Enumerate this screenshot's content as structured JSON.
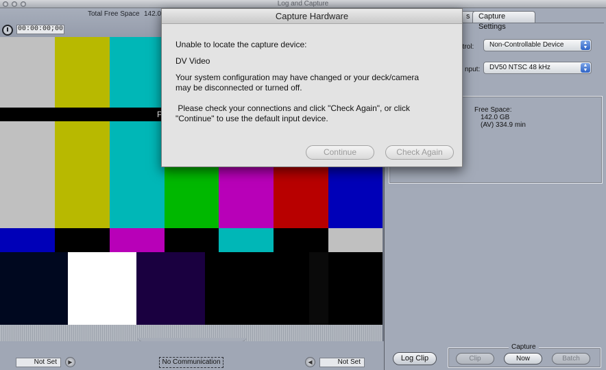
{
  "window": {
    "title": "Log and Capture"
  },
  "left_header": {
    "free_space_label": "Total Free Space",
    "free_space_value": "142.0",
    "timecode": "00:00:00;00"
  },
  "bars": {
    "strip_text": "P"
  },
  "bottom_left": {
    "in_point": "Not Set",
    "out_point": "Not Set",
    "status": "No Communication"
  },
  "right_pane": {
    "tabs": [
      {
        "label": "s"
      },
      {
        "label": "Capture Settings"
      }
    ],
    "device_control_label": "ntrol:",
    "device_control_value": "Non-Controllable Device",
    "capture_input_label": "nput:",
    "capture_input_value": "DV50 NTSC 48 kHz",
    "free_space": {
      "label": "Free Space:",
      "size": "142.0 GB",
      "time": "(AV) 334.9 min"
    },
    "log_clip_button": "Log Clip",
    "capture_group_label": "Capture",
    "capture_buttons": [
      {
        "label": "Clip",
        "enabled": false
      },
      {
        "label": "Now",
        "enabled": true
      },
      {
        "label": "Batch",
        "enabled": false
      }
    ]
  },
  "dialog": {
    "title": "Capture Hardware",
    "message_1": "Unable to locate the capture device:",
    "device_name": "DV Video",
    "message_2_line1": "Your system configuration may have changed or your deck/camera",
    "message_2_line2": "may be disconnected or turned off.",
    "message_3_line1": " Please check your connections and click \"Check Again\", or click",
    "message_3_line2": "\"Continue\" to use the default input device.",
    "continue_button": "Continue",
    "check_again_button": "Check Again"
  },
  "colors": {
    "bar_gray": "#c0c0c0",
    "bar_yellow": "#b8b900",
    "bar_cyan": "#00b7b7",
    "bar_green": "#00b800",
    "bar_magenta": "#b800b8",
    "bar_red": "#b80000",
    "bar_blue": "#0000b8"
  },
  "icons": {
    "clock": "clock-icon",
    "prev": "step-back-icon",
    "next": "step-forward-icon",
    "popup": "popup-arrows-icon"
  }
}
